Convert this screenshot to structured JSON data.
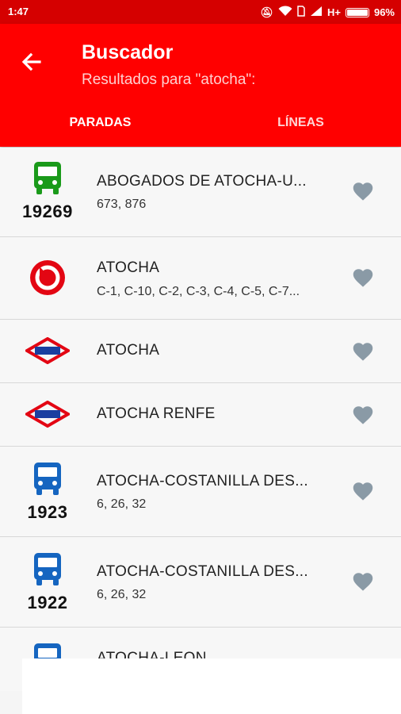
{
  "status_bar": {
    "time": "1:47",
    "network": "H+",
    "battery": "96%",
    "icons": [
      "mute-icon",
      "wifi-icon",
      "sim-icon",
      "signal-icon",
      "battery-icon"
    ]
  },
  "header": {
    "title": "Buscador",
    "subtitle": "Resultados para \"atocha\":",
    "back_icon": "arrow-back-icon",
    "background": "#ff0000"
  },
  "tabs": [
    {
      "label": "PARADAS",
      "active": true
    },
    {
      "label": "LÍNEAS",
      "active": false
    }
  ],
  "results": [
    {
      "type": "bus-green",
      "code": "19269",
      "name": "ABOGADOS DE ATOCHA-U...",
      "lines": "673, 876",
      "color": "#1a9a1a"
    },
    {
      "type": "cercanias",
      "code": "",
      "name": "ATOCHA",
      "lines": "C-1, C-10, C-2, C-3, C-4, C-5, C-7...",
      "color": "#e30613"
    },
    {
      "type": "metro",
      "code": "",
      "name": "ATOCHA",
      "lines": "",
      "color": "#e30613"
    },
    {
      "type": "metro",
      "code": "",
      "name": "ATOCHA RENFE",
      "lines": "",
      "color": "#e30613"
    },
    {
      "type": "bus-blue",
      "code": "1923",
      "name": "ATOCHA-COSTANILLA DES...",
      "lines": "6, 26, 32",
      "color": "#1565c0"
    },
    {
      "type": "bus-blue",
      "code": "1922",
      "name": "ATOCHA-COSTANILLA DES...",
      "lines": "6, 26, 32",
      "color": "#1565c0"
    },
    {
      "type": "bus-blue",
      "code": "",
      "name": "ATOCHA-LEON",
      "lines": "",
      "color": "#1565c0"
    }
  ],
  "colors": {
    "favorite_icon": "#8a9aa6",
    "divider": "#d8d8d8"
  }
}
